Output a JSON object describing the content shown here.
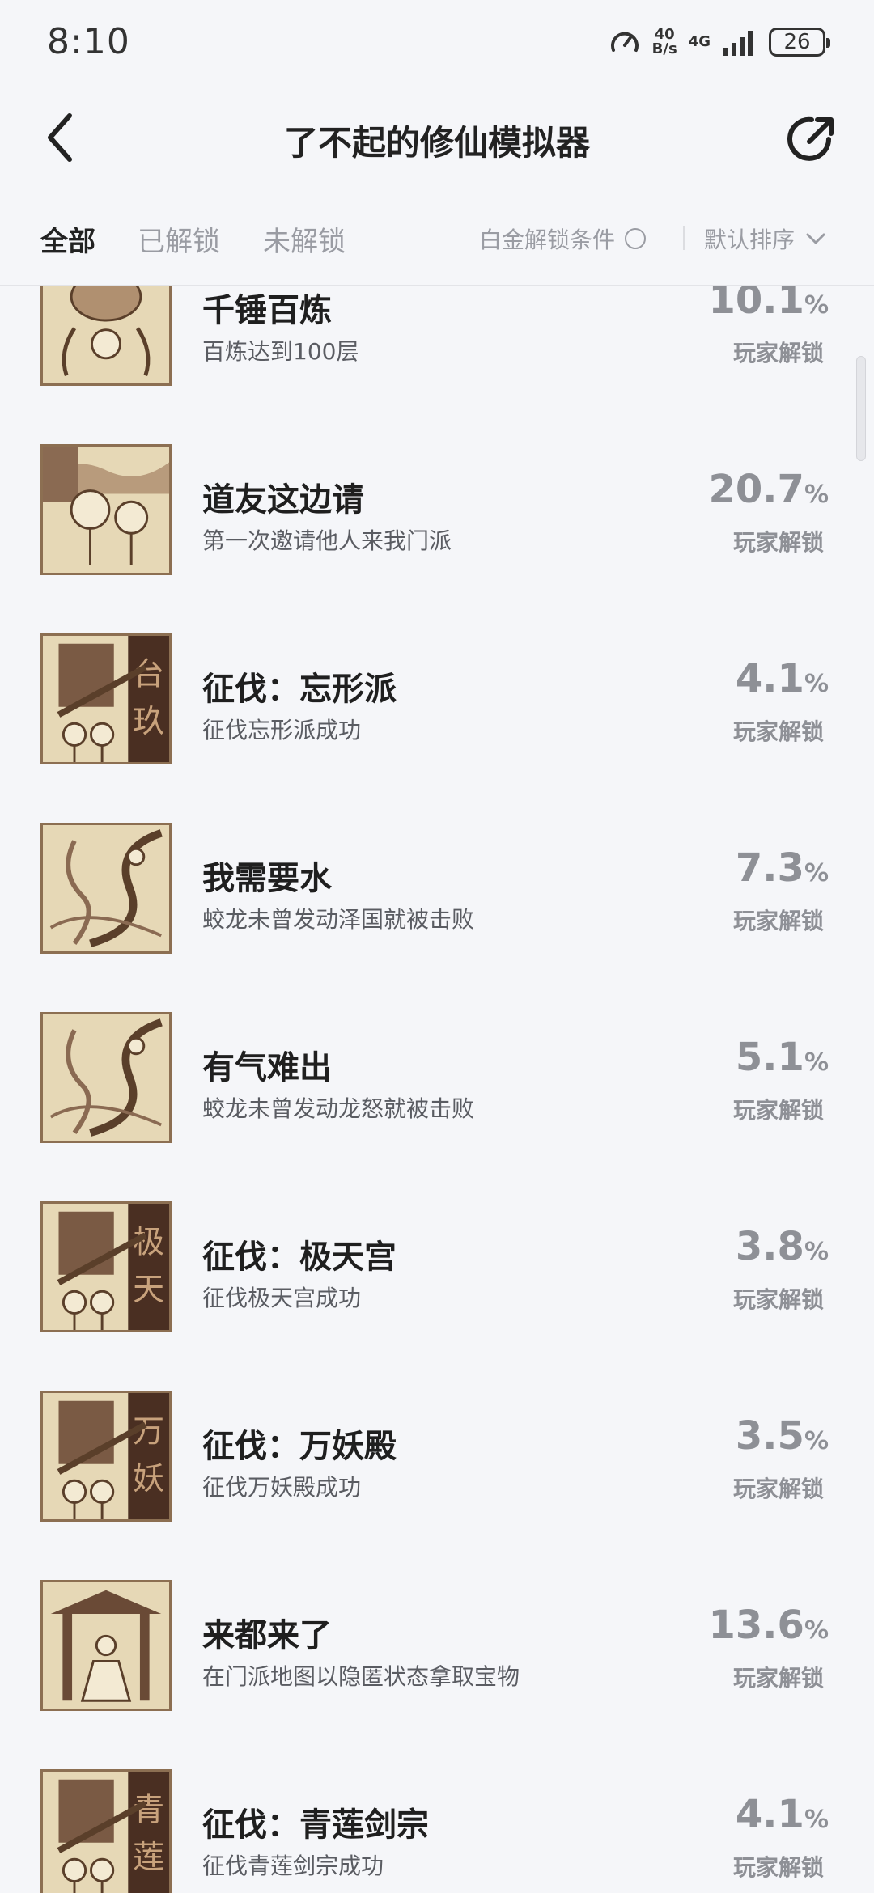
{
  "status_bar": {
    "time": "8:10",
    "speed_value": "40",
    "speed_unit": "B/s",
    "network": "4G",
    "battery": "26"
  },
  "header": {
    "title": "了不起的修仙模拟器",
    "back_icon": "chevron-left-icon",
    "share_icon": "share-icon"
  },
  "tabs": {
    "all": "全部",
    "unlocked": "已解锁",
    "locked": "未解锁",
    "platinum_filter": "白金解锁条件",
    "sort": "默认排序"
  },
  "achievements": [
    {
      "title": "千锤百炼",
      "desc": "百炼达到100层",
      "pct": "10.1",
      "unit": "%",
      "label": "玩家解锁"
    },
    {
      "title": "道友这边请",
      "desc": "第一次邀请他人来我门派",
      "pct": "20.7",
      "unit": "%",
      "label": "玩家解锁"
    },
    {
      "title": "征伐：忘形派",
      "desc": "征伐忘形派成功",
      "pct": "4.1",
      "unit": "%",
      "label": "玩家解锁"
    },
    {
      "title": "我需要水",
      "desc": "蛟龙未曾发动泽国就被击败",
      "pct": "7.3",
      "unit": "%",
      "label": "玩家解锁"
    },
    {
      "title": "有气难出",
      "desc": "蛟龙未曾发动龙怒就被击败",
      "pct": "5.1",
      "unit": "%",
      "label": "玩家解锁"
    },
    {
      "title": "征伐：极天宫",
      "desc": "征伐极天宫成功",
      "pct": "3.8",
      "unit": "%",
      "label": "玩家解锁"
    },
    {
      "title": "征伐：万妖殿",
      "desc": "征伐万妖殿成功",
      "pct": "3.5",
      "unit": "%",
      "label": "玩家解锁"
    },
    {
      "title": "来都来了",
      "desc": "在门派地图以隐匿状态拿取宝物",
      "pct": "13.6",
      "unit": "%",
      "label": "玩家解锁"
    },
    {
      "title": "征伐：青莲剑宗",
      "desc": "征伐青莲剑宗成功",
      "pct": "4.1",
      "unit": "%",
      "label": "玩家解锁"
    }
  ],
  "banner_glyphs": [
    "台",
    "玖",
    "极",
    "天",
    "万",
    "妖",
    "青",
    "莲"
  ]
}
